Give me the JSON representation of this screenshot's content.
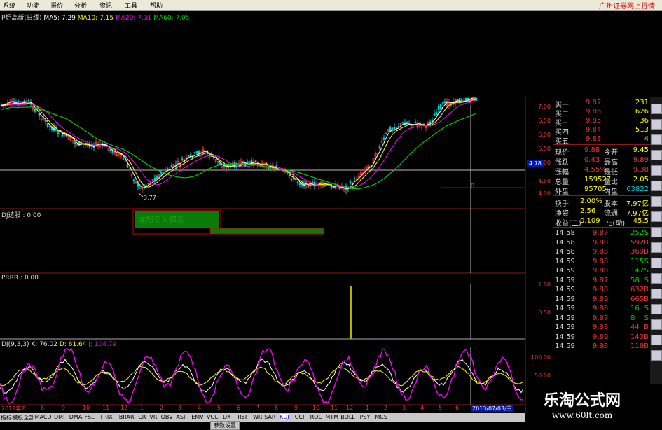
{
  "menu": {
    "items": [
      "系统",
      "功能",
      "报价",
      "分析",
      "资讯",
      "工具",
      "帮助"
    ],
    "brand": "广州证券网上行情"
  },
  "price_legend": {
    "name": "P炬高新(日线)",
    "ma5": "MA5: 7.29",
    "ma10": "MA10: 7.15",
    "ma20": "MA20: 7.31",
    "ma60": "MA60: 7.05"
  },
  "price_axis": [
    "7.00",
    "6.50",
    "6.00",
    "5.50",
    "5.00",
    "4.50",
    "4.00"
  ],
  "current_price_tag": "4.78",
  "low_label": "3.77",
  "r_mark": "R",
  "indicator1": {
    "label": "DJ选股 : 0.00",
    "box_text": "底部买入提示"
  },
  "indicator2": {
    "label": "PRRR : 0.00",
    "axis": [
      "1.00",
      "0.50"
    ]
  },
  "indicator3": {
    "label_k": "DJ(9,3,3) K: 76.02",
    "label_d": "D: 61.64",
    "label_j": "J: 104.79",
    "axis": [
      "100.00",
      "50.00"
    ]
  },
  "x_axis": [
    "2011年7",
    "8",
    "9",
    "10",
    "11",
    "12",
    "1",
    "2",
    "3",
    "4",
    "5",
    "6",
    "7",
    "8",
    "9",
    "10",
    "11",
    "12",
    "1",
    "2",
    "3",
    "4",
    "5",
    "6"
  ],
  "date_flag": "2013/07/03/三",
  "tabs": [
    "指标",
    "模板",
    "全部",
    "MACD",
    "DMI",
    "DMA",
    "FSL",
    "TRIX",
    "BRAR",
    "CR",
    "VR",
    "OBV",
    "ASI",
    "EMV",
    "VOL-TDX",
    "RSI",
    "WR",
    "SAR",
    "KDJ",
    "CCI",
    "ROC",
    "MTM",
    "BOLL",
    "PSY",
    "MCST"
  ],
  "tab_setting": "参数设置",
  "quote": {
    "bids": [
      {
        "label": "买一",
        "price": "9.87",
        "vol": "231"
      },
      {
        "label": "买二",
        "price": "9.86",
        "vol": "626"
      },
      {
        "label": "买三",
        "price": "9.85",
        "vol": "36"
      },
      {
        "label": "买四",
        "price": "9.84",
        "vol": "513"
      },
      {
        "label": "买五",
        "price": "9.83",
        "vol": "4"
      }
    ],
    "stats": [
      {
        "l1": "现价",
        "v1": "9.88",
        "l2": "今开",
        "v2": "9.45"
      },
      {
        "l1": "涨跌",
        "v1": "0.43",
        "l2": "最高",
        "v2": "9.89"
      },
      {
        "l1": "涨幅",
        "v1": "4.55%",
        "l2": "最低",
        "v2": "9.38"
      },
      {
        "l1": "总量",
        "v1": "159527",
        "l2": "量比",
        "v2": "2.05"
      },
      {
        "l1": "外盘",
        "v1": "95705",
        "l2": "内盘",
        "v2": "63822"
      }
    ],
    "extra": [
      {
        "l1": "换手",
        "v1": "2.00%",
        "l2": "股本",
        "v2": "7.97亿"
      },
      {
        "l1": "净资",
        "v1": "2.56",
        "l2": "流通",
        "v2": "7.97亿"
      },
      {
        "l1": "收益(二)",
        "v1": "0.109",
        "l2": "PE(动)",
        "v2": "45.5"
      }
    ],
    "ticks": [
      {
        "t": "14:58",
        "p": "9.87",
        "v": "252",
        "s": "S"
      },
      {
        "t": "14:58",
        "p": "9.88",
        "v": "592",
        "s": "B"
      },
      {
        "t": "14:58",
        "p": "9.88",
        "v": "369",
        "s": "B"
      },
      {
        "t": "14:59",
        "p": "9.88",
        "v": "115",
        "s": "S"
      },
      {
        "t": "14:59",
        "p": "9.88",
        "v": "147",
        "s": "S"
      },
      {
        "t": "14:59",
        "p": "9.87",
        "v": "58",
        "s": "S"
      },
      {
        "t": "14:59",
        "p": "9.88",
        "v": "632",
        "s": "B"
      },
      {
        "t": "14:59",
        "p": "9.89",
        "v": "665",
        "s": "B"
      },
      {
        "t": "14:59",
        "p": "9.88",
        "v": "16",
        "s": "S"
      },
      {
        "t": "14:59",
        "p": "9.87",
        "v": "8",
        "s": "S"
      },
      {
        "t": "14:59",
        "p": "9.88",
        "v": "44",
        "s": "B"
      },
      {
        "t": "14:59",
        "p": "9.89",
        "v": "143",
        "s": "B"
      },
      {
        "t": "14:59",
        "p": "9.88",
        "v": "118",
        "s": "B"
      }
    ]
  },
  "watermark": {
    "title": "乐淘公式网",
    "url": "www.60lt.com"
  },
  "colors": {
    "up": "#ff3333",
    "down": "#00cccc",
    "ma5": "#ffffff",
    "ma10": "#ffff00",
    "ma20": "#ff00ff",
    "ma60": "#00cc00",
    "kdj_k": "#ffffff",
    "kdj_d": "#ffff00",
    "kdj_j": "#ff00ff",
    "green_box": "#0a7a0a"
  }
}
